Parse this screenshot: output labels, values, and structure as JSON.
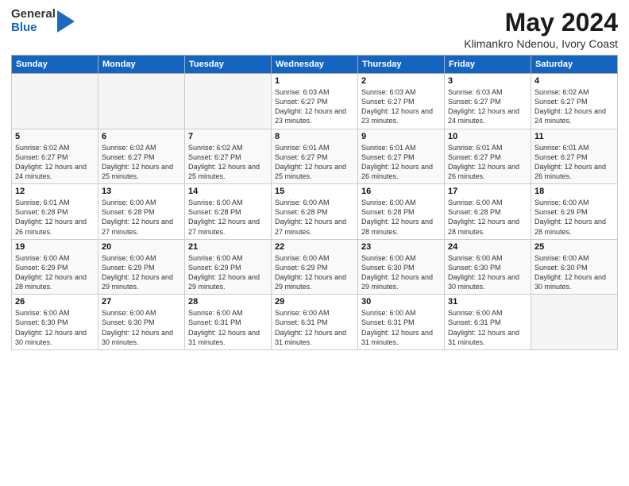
{
  "header": {
    "logo": {
      "general": "General",
      "blue": "Blue"
    },
    "title": "May 2024",
    "location": "Klimankro Ndenou, Ivory Coast"
  },
  "weekdays": [
    "Sunday",
    "Monday",
    "Tuesday",
    "Wednesday",
    "Thursday",
    "Friday",
    "Saturday"
  ],
  "weeks": [
    [
      {
        "day": "",
        "empty": true
      },
      {
        "day": "",
        "empty": true
      },
      {
        "day": "",
        "empty": true
      },
      {
        "day": "1",
        "sunrise": "Sunrise: 6:03 AM",
        "sunset": "Sunset: 6:27 PM",
        "daylight": "Daylight: 12 hours and 23 minutes."
      },
      {
        "day": "2",
        "sunrise": "Sunrise: 6:03 AM",
        "sunset": "Sunset: 6:27 PM",
        "daylight": "Daylight: 12 hours and 23 minutes."
      },
      {
        "day": "3",
        "sunrise": "Sunrise: 6:03 AM",
        "sunset": "Sunset: 6:27 PM",
        "daylight": "Daylight: 12 hours and 24 minutes."
      },
      {
        "day": "4",
        "sunrise": "Sunrise: 6:02 AM",
        "sunset": "Sunset: 6:27 PM",
        "daylight": "Daylight: 12 hours and 24 minutes."
      }
    ],
    [
      {
        "day": "5",
        "sunrise": "Sunrise: 6:02 AM",
        "sunset": "Sunset: 6:27 PM",
        "daylight": "Daylight: 12 hours and 24 minutes."
      },
      {
        "day": "6",
        "sunrise": "Sunrise: 6:02 AM",
        "sunset": "Sunset: 6:27 PM",
        "daylight": "Daylight: 12 hours and 25 minutes."
      },
      {
        "day": "7",
        "sunrise": "Sunrise: 6:02 AM",
        "sunset": "Sunset: 6:27 PM",
        "daylight": "Daylight: 12 hours and 25 minutes."
      },
      {
        "day": "8",
        "sunrise": "Sunrise: 6:01 AM",
        "sunset": "Sunset: 6:27 PM",
        "daylight": "Daylight: 12 hours and 25 minutes."
      },
      {
        "day": "9",
        "sunrise": "Sunrise: 6:01 AM",
        "sunset": "Sunset: 6:27 PM",
        "daylight": "Daylight: 12 hours and 26 minutes."
      },
      {
        "day": "10",
        "sunrise": "Sunrise: 6:01 AM",
        "sunset": "Sunset: 6:27 PM",
        "daylight": "Daylight: 12 hours and 26 minutes."
      },
      {
        "day": "11",
        "sunrise": "Sunrise: 6:01 AM",
        "sunset": "Sunset: 6:27 PM",
        "daylight": "Daylight: 12 hours and 26 minutes."
      }
    ],
    [
      {
        "day": "12",
        "sunrise": "Sunrise: 6:01 AM",
        "sunset": "Sunset: 6:28 PM",
        "daylight": "Daylight: 12 hours and 26 minutes."
      },
      {
        "day": "13",
        "sunrise": "Sunrise: 6:00 AM",
        "sunset": "Sunset: 6:28 PM",
        "daylight": "Daylight: 12 hours and 27 minutes."
      },
      {
        "day": "14",
        "sunrise": "Sunrise: 6:00 AM",
        "sunset": "Sunset: 6:28 PM",
        "daylight": "Daylight: 12 hours and 27 minutes."
      },
      {
        "day": "15",
        "sunrise": "Sunrise: 6:00 AM",
        "sunset": "Sunset: 6:28 PM",
        "daylight": "Daylight: 12 hours and 27 minutes."
      },
      {
        "day": "16",
        "sunrise": "Sunrise: 6:00 AM",
        "sunset": "Sunset: 6:28 PM",
        "daylight": "Daylight: 12 hours and 28 minutes."
      },
      {
        "day": "17",
        "sunrise": "Sunrise: 6:00 AM",
        "sunset": "Sunset: 6:28 PM",
        "daylight": "Daylight: 12 hours and 28 minutes."
      },
      {
        "day": "18",
        "sunrise": "Sunrise: 6:00 AM",
        "sunset": "Sunset: 6:29 PM",
        "daylight": "Daylight: 12 hours and 28 minutes."
      }
    ],
    [
      {
        "day": "19",
        "sunrise": "Sunrise: 6:00 AM",
        "sunset": "Sunset: 6:29 PM",
        "daylight": "Daylight: 12 hours and 28 minutes."
      },
      {
        "day": "20",
        "sunrise": "Sunrise: 6:00 AM",
        "sunset": "Sunset: 6:29 PM",
        "daylight": "Daylight: 12 hours and 29 minutes."
      },
      {
        "day": "21",
        "sunrise": "Sunrise: 6:00 AM",
        "sunset": "Sunset: 6:29 PM",
        "daylight": "Daylight: 12 hours and 29 minutes."
      },
      {
        "day": "22",
        "sunrise": "Sunrise: 6:00 AM",
        "sunset": "Sunset: 6:29 PM",
        "daylight": "Daylight: 12 hours and 29 minutes."
      },
      {
        "day": "23",
        "sunrise": "Sunrise: 6:00 AM",
        "sunset": "Sunset: 6:30 PM",
        "daylight": "Daylight: 12 hours and 29 minutes."
      },
      {
        "day": "24",
        "sunrise": "Sunrise: 6:00 AM",
        "sunset": "Sunset: 6:30 PM",
        "daylight": "Daylight: 12 hours and 30 minutes."
      },
      {
        "day": "25",
        "sunrise": "Sunrise: 6:00 AM",
        "sunset": "Sunset: 6:30 PM",
        "daylight": "Daylight: 12 hours and 30 minutes."
      }
    ],
    [
      {
        "day": "26",
        "sunrise": "Sunrise: 6:00 AM",
        "sunset": "Sunset: 6:30 PM",
        "daylight": "Daylight: 12 hours and 30 minutes."
      },
      {
        "day": "27",
        "sunrise": "Sunrise: 6:00 AM",
        "sunset": "Sunset: 6:30 PM",
        "daylight": "Daylight: 12 hours and 30 minutes."
      },
      {
        "day": "28",
        "sunrise": "Sunrise: 6:00 AM",
        "sunset": "Sunset: 6:31 PM",
        "daylight": "Daylight: 12 hours and 31 minutes."
      },
      {
        "day": "29",
        "sunrise": "Sunrise: 6:00 AM",
        "sunset": "Sunset: 6:31 PM",
        "daylight": "Daylight: 12 hours and 31 minutes."
      },
      {
        "day": "30",
        "sunrise": "Sunrise: 6:00 AM",
        "sunset": "Sunset: 6:31 PM",
        "daylight": "Daylight: 12 hours and 31 minutes."
      },
      {
        "day": "31",
        "sunrise": "Sunrise: 6:00 AM",
        "sunset": "Sunset: 6:31 PM",
        "daylight": "Daylight: 12 hours and 31 minutes."
      },
      {
        "day": "",
        "empty": true
      }
    ]
  ]
}
